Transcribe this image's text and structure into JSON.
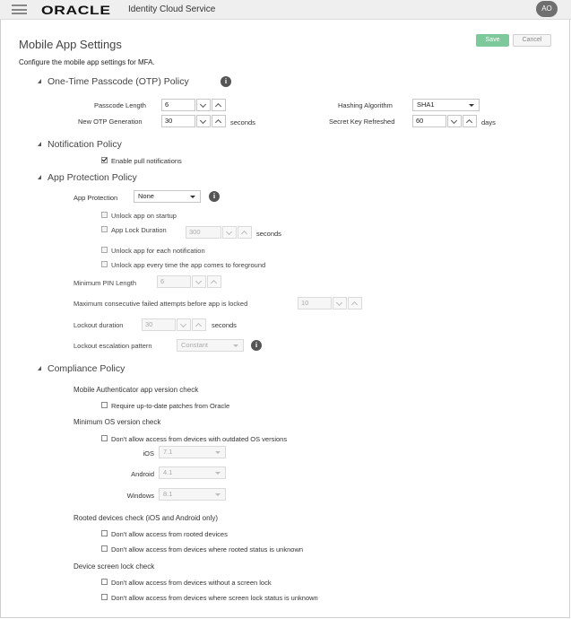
{
  "header": {
    "logo": "ORACLE",
    "product": "Identity Cloud Service",
    "avatar": "AO"
  },
  "page": {
    "title": "Mobile App Settings",
    "subtitle": "Configure the mobile app settings for MFA.",
    "save": "Save",
    "cancel": "Cancel"
  },
  "otp": {
    "title": "One-Time Passcode (OTP) Policy",
    "passcode_length_label": "Passcode Length",
    "passcode_length": "6",
    "hashing_label": "Hashing Algorithm",
    "hashing": "SHA1",
    "generation_label": "New OTP Generation",
    "generation": "30",
    "generation_unit": "seconds",
    "secret_label": "Secret Key Refreshed",
    "secret": "60",
    "secret_unit": "days"
  },
  "notification": {
    "title": "Notification Policy",
    "enable_pull": "Enable pull notifications",
    "enable_pull_checked": true
  },
  "protection": {
    "title": "App Protection Policy",
    "label": "App Protection",
    "value": "None",
    "unlock_startup": "Unlock app on startup",
    "lock_duration_label": "App Lock Duration",
    "lock_duration": "300",
    "lock_duration_unit": "seconds",
    "unlock_notification": "Unlock app for each notification",
    "unlock_foreground": "Unlock app every time the app comes to foreground",
    "min_pin_label": "Minimum PIN Length",
    "min_pin": "6",
    "max_failed_label": "Maximum consecutive failed attempts before app is locked",
    "max_failed": "10",
    "lockout_duration_label": "Lockout duration",
    "lockout_duration": "30",
    "lockout_duration_unit": "seconds",
    "escalation_label": "Lockout escalation pattern",
    "escalation": "Constant"
  },
  "compliance": {
    "title": "Compliance Policy",
    "app_version_title": "Mobile Authenticator app version check",
    "require_patches": "Require up-to-date patches from Oracle",
    "min_os_title": "Minimum OS version check",
    "outdated_os": "Don't allow access from devices with outdated OS versions",
    "ios_label": "iOS",
    "ios": "7.1",
    "android_label": "Android",
    "android": "4.1",
    "windows_label": "Windows",
    "windows": "8.1",
    "rooted_title": "Rooted devices check (iOS and Android only)",
    "rooted_block": "Don't allow access from rooted devices",
    "rooted_unknown": "Don't allow access from devices where rooted status is unknown",
    "screen_lock_title": "Device screen lock check",
    "no_screen_lock": "Don't allow access from devices without a screen lock",
    "screen_lock_unknown": "Don't allow access from devices where screen lock status is unknown"
  }
}
